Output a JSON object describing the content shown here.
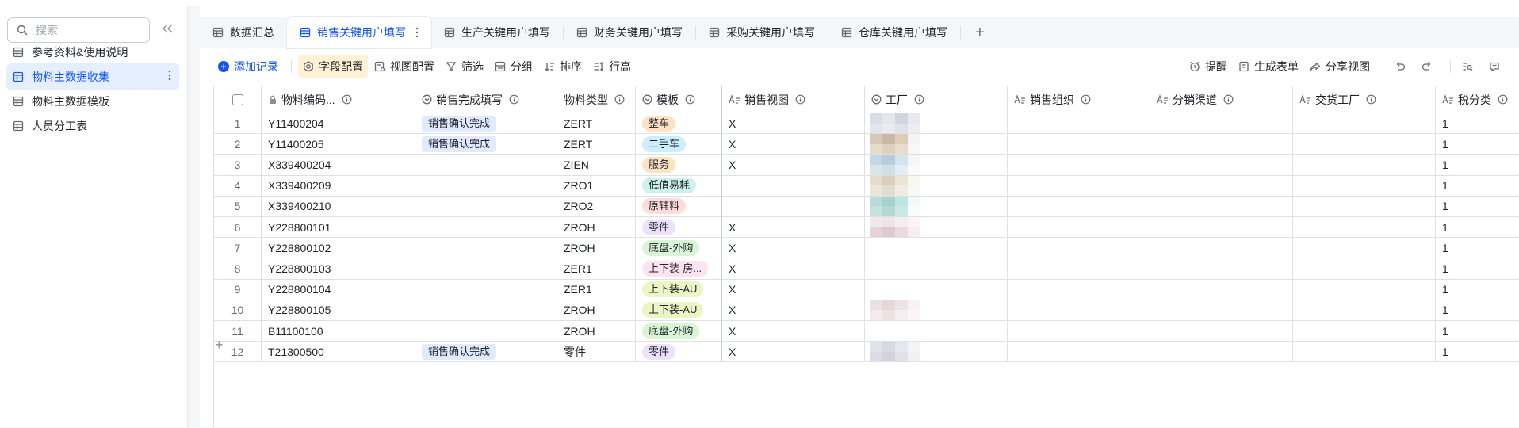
{
  "sidebar": {
    "search_placeholder": "搜索",
    "items": [
      {
        "label": "参考资料&使用说明",
        "active": false
      },
      {
        "label": "物料主数据收集",
        "active": true
      },
      {
        "label": "物料主数据模板",
        "active": false
      },
      {
        "label": "人员分工表",
        "active": false
      }
    ]
  },
  "tabs": [
    {
      "label": "数据汇总",
      "active": false
    },
    {
      "label": "销售关键用户填写",
      "active": true
    },
    {
      "label": "生产关键用户填写",
      "active": false
    },
    {
      "label": "财务关键用户填写",
      "active": false
    },
    {
      "label": "采购关键用户填写",
      "active": false
    },
    {
      "label": "仓库关键用户填写",
      "active": false
    }
  ],
  "toolbar": {
    "add_record": "添加记录",
    "field_config": "字段配置",
    "view_config": "视图配置",
    "filter": "筛选",
    "group": "分组",
    "sort": "排序",
    "row_height": "行高",
    "remind": "提醒",
    "generate_form": "生成表单",
    "share_view": "分享视图"
  },
  "columns": [
    {
      "label": "物料编码...",
      "type_icon": "lock-icon"
    },
    {
      "label": "销售完成填写",
      "type_icon": "single-select-icon"
    },
    {
      "label": "物料类型",
      "type_icon": "none"
    },
    {
      "label": "模板",
      "type_icon": "single-select-icon"
    },
    {
      "label": "销售视图",
      "type_icon": "text-field-icon"
    },
    {
      "label": "工厂",
      "type_icon": "single-select-icon"
    },
    {
      "label": "销售组织",
      "type_icon": "text-field-icon"
    },
    {
      "label": "分销渠道",
      "type_icon": "text-field-icon"
    },
    {
      "label": "交货工厂",
      "type_icon": "text-field-icon"
    },
    {
      "label": "税分类",
      "type_icon": "text-field-icon"
    }
  ],
  "colors": {
    "accent": "#1456f0",
    "status_tag": "#e1eaff"
  },
  "rows": [
    {
      "no": "1",
      "code": "Y11400204",
      "status": "销售确认完成",
      "type": "ZERT",
      "template": "整车",
      "template_color": "#fde2c4",
      "sales_view": "X",
      "sales_org": "",
      "channel": "",
      "delivery_plant": "",
      "tax": "1",
      "plant_blur": [
        "#dcdce6",
        "#e6e6ee",
        "#d4d4de",
        "#e8e8f0",
        "#e4e4ec",
        "#eaeaf0",
        "#e0e0ea",
        "#ececf2"
      ]
    },
    {
      "no": "2",
      "code": "Y11400205",
      "status": "销售确认完成",
      "type": "ZERT",
      "template": "二手车",
      "template_color": "#cdeefc",
      "sales_view": "X",
      "sales_org": "",
      "channel": "",
      "delivery_plant": "",
      "tax": "1",
      "plant_blur": [
        "#d8c8b8",
        "#c8b8a4",
        "#dcccb8",
        "#f4f4f4",
        "#e6dccc",
        "#ddd0c0",
        "#e8dccc",
        "#f8f8f8"
      ]
    },
    {
      "no": "3",
      "code": "X339400204",
      "status": "",
      "type": "ZIEN",
      "template": "服务",
      "template_color": "#fde2c4",
      "sales_view": "X",
      "sales_org": "",
      "channel": "",
      "delivery_plant": "",
      "tax": "1",
      "plant_blur": [
        "#c4d8e4",
        "#b8ccdc",
        "#d4e4ec",
        "#f4f8fa",
        "#d8e4ea",
        "#d0dee6",
        "#e4eef2",
        "#f8fafc"
      ]
    },
    {
      "no": "4",
      "code": "X339400209",
      "status": "",
      "type": "ZRO1",
      "template": "低值易耗",
      "template_color": "#cdf2ee",
      "sales_view": "",
      "sales_org": "",
      "channel": "",
      "delivery_plant": "",
      "tax": "1",
      "plant_blur": [
        "#e4dccc",
        "#d8d0bc",
        "#ece4d4",
        "#f8f6f0",
        "#ebe6da",
        "#e2dccc",
        "#f0ece2",
        "#faf8f4"
      ]
    },
    {
      "no": "5",
      "code": "X339400210",
      "status": "",
      "type": "ZRO2",
      "template": "原辅料",
      "template_color": "#fcdcdc",
      "sales_view": "",
      "sales_org": "",
      "channel": "",
      "delivery_plant": "",
      "tax": "1",
      "plant_blur": [
        "#b8dcd8",
        "#a8d0cc",
        "#c0e4e0",
        "#f4fafa",
        "#c4e2de",
        "#b4d8d4",
        "#cce8e4",
        "#f8fcfc"
      ]
    },
    {
      "no": "6",
      "code": "Y228800101",
      "status": "",
      "type": "ZROH",
      "template": "零件",
      "template_color": "#ece2fe",
      "sales_view": "X",
      "sales_org": "",
      "channel": "",
      "delivery_plant": "",
      "tax": "1",
      "plant_blur": [
        "#f0e8ea",
        "#ece4e6",
        "#f4eef0",
        "#faf4f6",
        "#e4d4d8",
        "#dccccf",
        "#e8dadd",
        "#f6eef0"
      ]
    },
    {
      "no": "7",
      "code": "Y228800102",
      "status": "",
      "type": "ZROH",
      "template": "底盘-外购",
      "template_color": "#d9f5d6",
      "sales_view": "X",
      "sales_org": "",
      "channel": "",
      "delivery_plant": "",
      "tax": "1",
      "plant_blur": [
        "#ffffff",
        "#ffffff",
        "#ffffff",
        "#ffffff",
        "#ffffff",
        "#ffffff",
        "#ffffff",
        "#ffffff"
      ]
    },
    {
      "no": "8",
      "code": "Y228800103",
      "status": "",
      "type": "ZER1",
      "template": "上下装-房...",
      "template_color": "#fde2f2",
      "sales_view": "X",
      "sales_org": "",
      "channel": "",
      "delivery_plant": "",
      "tax": "1",
      "plant_blur": [
        "#ffffff",
        "#ffffff",
        "#ffffff",
        "#ffffff",
        "#ffffff",
        "#ffffff",
        "#ffffff",
        "#ffffff"
      ]
    },
    {
      "no": "9",
      "code": "Y228800104",
      "status": "",
      "type": "ZER1",
      "template": "上下装-AU",
      "template_color": "#ecf5c4",
      "sales_view": "X",
      "sales_org": "",
      "channel": "",
      "delivery_plant": "",
      "tax": "1",
      "plant_blur": [
        "#ffffff",
        "#ffffff",
        "#ffffff",
        "#ffffff",
        "#ffffff",
        "#ffffff",
        "#ffffff",
        "#ffffff"
      ]
    },
    {
      "no": "10",
      "code": "Y228800105",
      "status": "",
      "type": "ZROH",
      "template": "上下装-AU",
      "template_color": "#ecf5c4",
      "sales_view": "X",
      "sales_org": "",
      "channel": "",
      "delivery_plant": "",
      "tax": "1",
      "plant_blur": [
        "#ece2e4",
        "#e4d8da",
        "#eee4e6",
        "#f8f2f4",
        "#f2eaec",
        "#ece2e4",
        "#f4eef0",
        "#faf6f8"
      ]
    },
    {
      "no": "11",
      "code": "B11100100",
      "status": "",
      "type": "ZROH",
      "template": "底盘-外购",
      "template_color": "#d9f5d6",
      "sales_view": "X",
      "sales_org": "",
      "channel": "",
      "delivery_plant": "",
      "tax": "1",
      "plant_blur": [
        "#ffffff",
        "#ffffff",
        "#ffffff",
        "#ffffff",
        "#ffffff",
        "#ffffff",
        "#ffffff",
        "#ffffff"
      ]
    },
    {
      "no": "12",
      "code": "T21300500",
      "status": "销售确认完成",
      "type": "零件",
      "template": "零件",
      "template_color": "#ece2fe",
      "sales_view": "X",
      "sales_org": "",
      "channel": "",
      "delivery_plant": "",
      "tax": "1",
      "plant_blur": [
        "#e2e2ea",
        "#d8d8e2",
        "#e6e6ee",
        "#f4f4f8",
        "#dcdce6",
        "#d2d2dc",
        "#e0e0ea",
        "#f0f0f6"
      ]
    }
  ]
}
